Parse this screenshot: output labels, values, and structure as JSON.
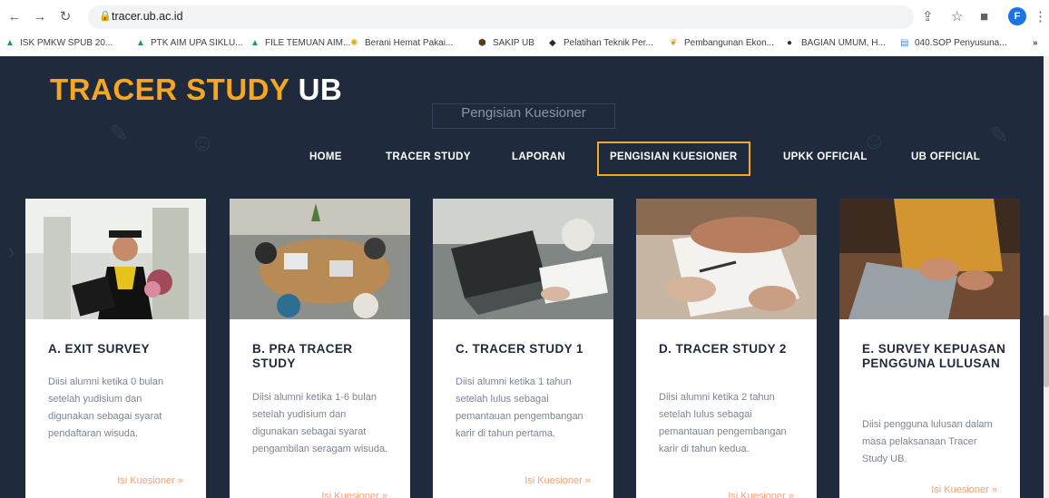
{
  "browser": {
    "url": "tracer.ub.ac.id",
    "profile_initial": "F",
    "bookmarks": [
      {
        "label": "ISK PMKW SPUB 20...",
        "icon": "drive-icon"
      },
      {
        "label": "PTK AIM UPA SIKLU...",
        "icon": "drive-icon"
      },
      {
        "label": "FILE TEMUAN AIM...",
        "icon": "drive-icon"
      },
      {
        "label": "Berani Hemat Pakai...",
        "icon": "sun-icon"
      },
      {
        "label": "SAKIP UB",
        "icon": "hexagon-icon"
      },
      {
        "label": "Pelatihan Teknik Per...",
        "icon": "graduation-cap-icon"
      },
      {
        "label": "Pembangunan Ekon...",
        "icon": "leaf-icon"
      },
      {
        "label": "BAGIAN UMUM, H...",
        "icon": "globe-icon"
      },
      {
        "label": "040.SOP Penyusuna...",
        "icon": "document-icon"
      }
    ],
    "more_label": "»"
  },
  "site": {
    "logo_main": "TRACER STUDY",
    "logo_suffix": "UB",
    "ghost_text": "Pengisian Kuesioner",
    "accent_color": "#f5a623",
    "nav": [
      {
        "label": "HOME"
      },
      {
        "label": "TRACER STUDY"
      },
      {
        "label": "LAPORAN"
      },
      {
        "label": "PENGISIAN KUESIONER",
        "active": true
      },
      {
        "label": "UPKK OFFICIAL"
      },
      {
        "label": "UB OFFICIAL"
      }
    ]
  },
  "cards": [
    {
      "title": "A. EXIT SURVEY",
      "description": "Diisi alumni ketika 0 bulan setelah yudisium dan digunakan sebagai syarat pendaftaran wisuda.",
      "link": "Isi Kuesioner »"
    },
    {
      "title": "B. PRA TRACER STUDY",
      "description": "Diisi alumni ketika 1-6 bulan setelah yudisium dan digunakan sebagai syarat pengambilan seragam wisuda.",
      "link": "Isi Kuesioner »"
    },
    {
      "title": "C. TRACER STUDY 1",
      "description": "Diisi alumni ketika 1 tahun setelah lulus sebagai pemantauan pengembangan karir di tahun pertama.",
      "link": "Isi Kuesioner »"
    },
    {
      "title": "D. TRACER STUDY 2",
      "description": "Diisi alumni ketika 2 tahun setelah lulus sebagai pemantauan pengembangan karir di tahun kedua.",
      "link": "Isi Kuesioner »"
    },
    {
      "title": "E. SURVEY KEPUASAN PENGGUNA LULUSAN",
      "description": "Diisi pengguna lulusan dalam masa pelaksanaan Tracer Study UB.",
      "link": "Isi Kuesioner »"
    }
  ]
}
